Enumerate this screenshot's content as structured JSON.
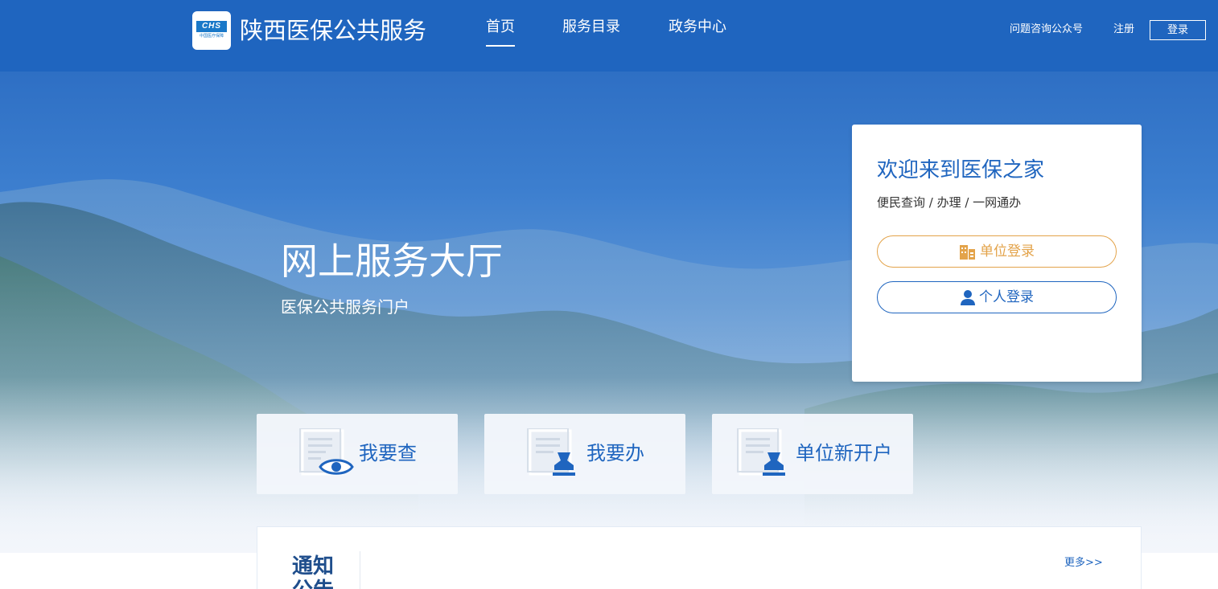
{
  "header": {
    "logo": {
      "badge": "CHS",
      "subtitle": "中国医疗保障"
    },
    "site_title": "陕西医保公共服务",
    "nav": [
      {
        "label": "首页",
        "active": true
      },
      {
        "label": "服务目录",
        "active": false
      },
      {
        "label": "政务中心",
        "active": false
      }
    ],
    "links": {
      "consult": "问题咨询公众号",
      "register": "注册",
      "login": "登录"
    }
  },
  "hero": {
    "title": "网上服务大厅",
    "subtitle": "医保公共服务门户"
  },
  "login_panel": {
    "welcome": "欢迎来到医保之家",
    "subtitle": "便民查询 / 办理 / 一网通办",
    "unit_login": {
      "label": "单位登录",
      "icon": "building-icon"
    },
    "personal_login": {
      "label": "个人登录",
      "icon": "user-icon"
    }
  },
  "service_cards": [
    {
      "label": "我要查",
      "icon": "document-eye-icon"
    },
    {
      "label": "我要办",
      "icon": "document-stamp-icon"
    },
    {
      "label": "单位新开户",
      "icon": "document-stamp-icon"
    }
  ],
  "notice": {
    "title": "通知公告",
    "more": "更多>>"
  },
  "colors": {
    "brand_blue": "#1f65bf",
    "unit_orange": "#e3a34a",
    "notice_title": "#1f4e8c"
  }
}
